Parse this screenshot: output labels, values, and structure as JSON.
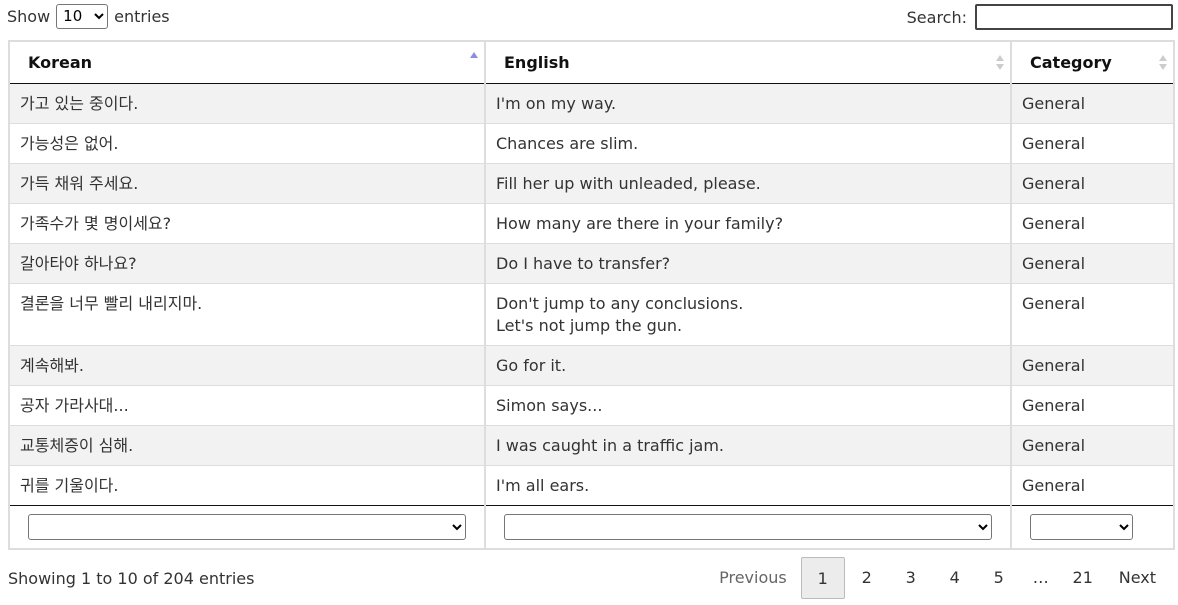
{
  "length_control": {
    "show_label": "Show",
    "selected": "10",
    "entries_label": "entries"
  },
  "search": {
    "label": "Search:",
    "value": ""
  },
  "table": {
    "headers": [
      "Korean",
      "English",
      "Category"
    ],
    "rows": [
      {
        "korean": "가고 있는 중이다.",
        "english": "I'm on my way.",
        "category": "General"
      },
      {
        "korean": "가능성은 없어.",
        "english": "Chances are slim.",
        "category": "General"
      },
      {
        "korean": "가득 채워 주세요.",
        "english": "Fill her up with unleaded, please.",
        "category": "General"
      },
      {
        "korean": "가족수가 몇 명이세요?",
        "english": "How many are there in your family?",
        "category": "General"
      },
      {
        "korean": "갈아타야 하나요?",
        "english": "Do I have to transfer?",
        "category": "General"
      },
      {
        "korean": "결론을 너무 빨리 내리지마.",
        "english": "Don't jump to any conclusions.",
        "english2": "Let's not jump the gun.",
        "category": "General"
      },
      {
        "korean": "계속해봐.",
        "english": "Go for it.",
        "category": "General"
      },
      {
        "korean": "공자 가라사대...",
        "english": "Simon says...",
        "category": "General"
      },
      {
        "korean": "교통체증이 심해.",
        "english": "I was caught in a traffic jam.",
        "category": "General"
      },
      {
        "korean": "귀를 기울이다.",
        "english": "I'm all ears.",
        "category": "General"
      }
    ]
  },
  "info": "Showing 1 to 10 of 204 entries",
  "pagination": {
    "previous": "Previous",
    "pages": [
      "1",
      "2",
      "3",
      "4",
      "5"
    ],
    "ellipsis": "…",
    "last": "21",
    "next": "Next"
  },
  "colors": {
    "stripe": "#f2f2f2",
    "sort_active": "#8b8ee0",
    "border": "#dddddd"
  }
}
